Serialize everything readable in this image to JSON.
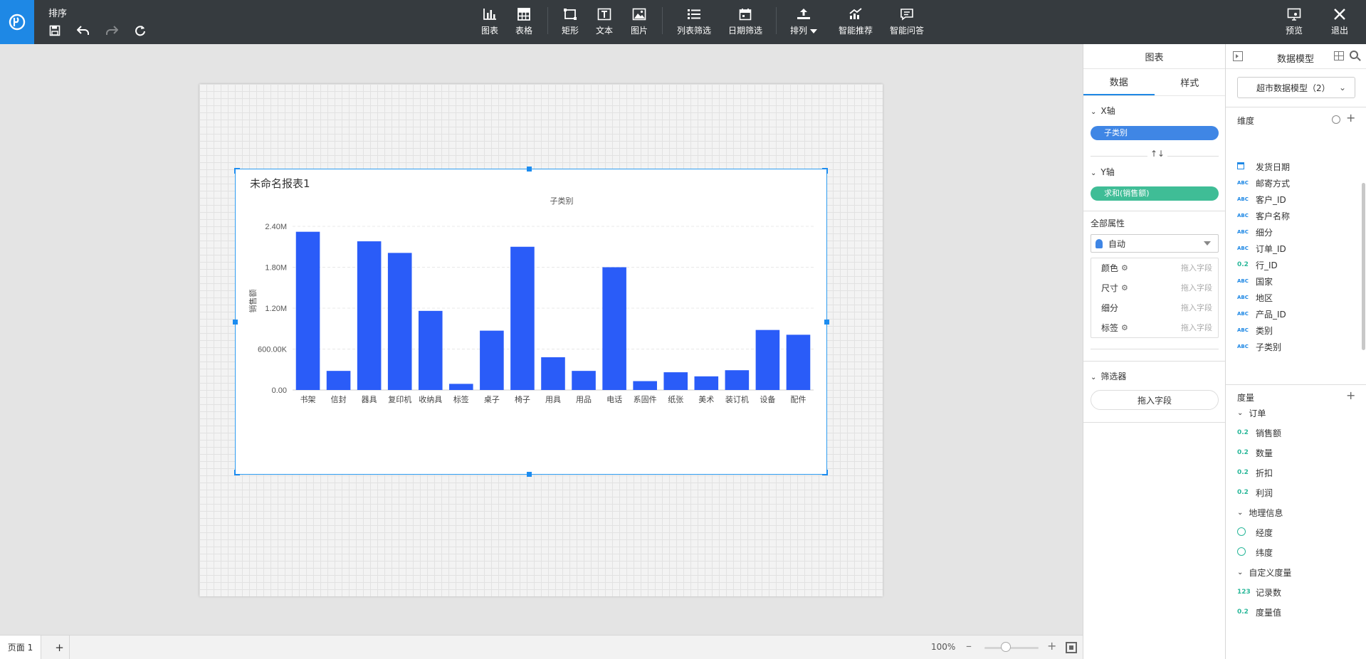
{
  "app": {
    "title": "排序"
  },
  "toolbar": {
    "tools": [
      {
        "id": "chart",
        "label": "图表"
      },
      {
        "id": "table",
        "label": "表格"
      },
      {
        "id": "rect",
        "label": "矩形"
      },
      {
        "id": "text",
        "label": "文本"
      },
      {
        "id": "image",
        "label": "图片"
      },
      {
        "id": "list-filter",
        "label": "列表筛选"
      },
      {
        "id": "date-filter",
        "label": "日期筛选"
      },
      {
        "id": "arrange",
        "label": "排列"
      },
      {
        "id": "smart-recommend",
        "label": "智能推荐"
      },
      {
        "id": "smart-qa",
        "label": "智能问答"
      }
    ],
    "preview_label": "预览",
    "exit_label": "退出"
  },
  "widget": {
    "title": "未命名报表1"
  },
  "chart_data": {
    "type": "bar",
    "title": "子类别",
    "xlabel": "",
    "ylabel": "销售额",
    "categories": [
      "书架",
      "信封",
      "器具",
      "复印机",
      "收纳具",
      "标签",
      "桌子",
      "椅子",
      "用具",
      "用品",
      "电话",
      "系固件",
      "纸张",
      "美术",
      "装订机",
      "设备",
      "配件"
    ],
    "values": [
      2320000,
      280000,
      2180000,
      2010000,
      1160000,
      90000,
      870000,
      2100000,
      480000,
      280000,
      1800000,
      130000,
      260000,
      200000,
      290000,
      880000,
      810000
    ],
    "yticks": [
      "0.00",
      "600.00K",
      "1.20M",
      "1.80M",
      "2.40M"
    ],
    "ylim": [
      0,
      2400000
    ],
    "grid": true,
    "color": "#2a5cf8"
  },
  "bottom": {
    "page_tab": "页面 1",
    "add_page": "+",
    "zoom": "100%",
    "zoom_level": 0.4
  },
  "props_panel": {
    "header": "图表",
    "tabs": [
      "数据",
      "样式"
    ],
    "x_axis_label": "X轴",
    "x_field": "子类别",
    "swap": "↑↓",
    "y_axis_label": "Y轴",
    "y_field": "求和(销售额)",
    "all_props_label": "全部属性",
    "mark_type": "自动",
    "props": [
      {
        "label": "颜色",
        "placeholder": "拖入字段"
      },
      {
        "label": "尺寸",
        "placeholder": "拖入字段"
      },
      {
        "label": "细分",
        "placeholder": "拖入字段"
      },
      {
        "label": "标签",
        "placeholder": "拖入字段"
      }
    ],
    "filter_label": "筛选器",
    "filter_drop": "拖入字段"
  },
  "model_panel": {
    "title": "数据模型",
    "model_name": "超市数据模型（2）",
    "dimension_label": "维度",
    "dimensions": [
      {
        "type": "date",
        "name": "发货日期"
      },
      {
        "type": "ABC",
        "name": "邮寄方式"
      },
      {
        "type": "ABC",
        "name": "客户_ID"
      },
      {
        "type": "ABC",
        "name": "客户名称"
      },
      {
        "type": "ABC",
        "name": "细分"
      },
      {
        "type": "ABC",
        "name": "订单_ID"
      },
      {
        "type": "0.2",
        "name": "行_ID"
      },
      {
        "type": "ABC",
        "name": "国家"
      },
      {
        "type": "ABC",
        "name": "地区"
      },
      {
        "type": "ABC",
        "name": "产品_ID"
      },
      {
        "type": "ABC",
        "name": "类别"
      },
      {
        "type": "ABC",
        "name": "子类别"
      }
    ],
    "measure_label": "度量",
    "measure_groups": [
      {
        "name": "订单",
        "fields": [
          {
            "type": "0.2",
            "name": "销售额"
          },
          {
            "type": "0.2",
            "name": "数量"
          },
          {
            "type": "0.2",
            "name": "折扣"
          },
          {
            "type": "0.2",
            "name": "利润"
          }
        ]
      },
      {
        "name": "地理信息",
        "fields": [
          {
            "type": "geo",
            "name": "经度"
          },
          {
            "type": "geo",
            "name": "纬度"
          }
        ]
      },
      {
        "name": "自定义度量",
        "fields": [
          {
            "type": "123",
            "name": "记录数"
          },
          {
            "type": "0.2",
            "name": "度量值"
          }
        ]
      }
    ]
  }
}
